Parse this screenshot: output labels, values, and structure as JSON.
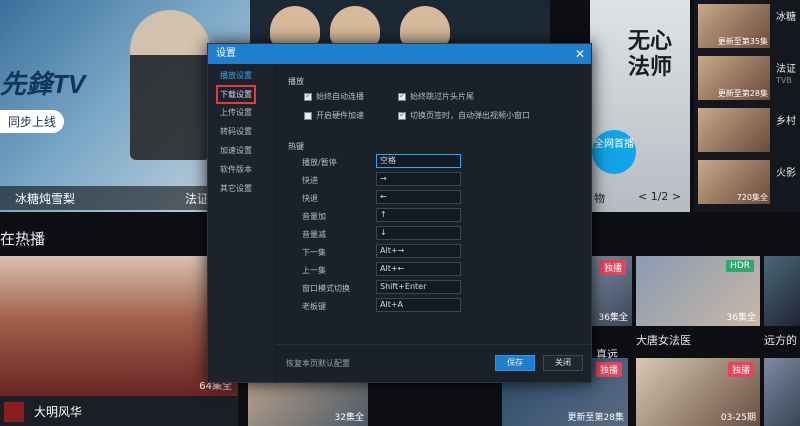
{
  "hero": {
    "logo": "先鋒TV",
    "sync": "同步上线",
    "caption_left": "冰糖炖雪梨",
    "caption_right": "法证先锋4",
    "side_title": "无心法师",
    "live_badge": "全网首播",
    "category": "物",
    "pager": "< 1/2 >"
  },
  "side_list": [
    {
      "name": "冰糖",
      "sub": "",
      "caption": "更新至第35集"
    },
    {
      "name": "法证",
      "sub": "TVB",
      "caption": "更新至第28集"
    },
    {
      "name": "乡村",
      "sub": "",
      "caption": ""
    },
    {
      "name": "火影",
      "sub": "",
      "caption": "720集全"
    }
  ],
  "section_title": "在热播",
  "big_poster": {
    "title": "大明风华",
    "caption": "64集全"
  },
  "tiles": [
    {
      "title": "真远",
      "caption": "36集全",
      "badge": "独播"
    },
    {
      "title": "大唐女法医",
      "caption": "36集全",
      "badge": "HDR"
    },
    {
      "title": "远方的",
      "caption": "",
      "badge": ""
    },
    {
      "title": "",
      "caption": "32集全",
      "badge": ""
    },
    {
      "title": "",
      "caption": "更新至第28集",
      "badge": "独播"
    },
    {
      "title": "",
      "caption": "03-25期",
      "badge": "独播"
    }
  ],
  "dialog": {
    "title": "设置",
    "close": "✕",
    "nav": [
      "播放设置",
      "下载设置",
      "上传设置",
      "转码设置",
      "加速设置",
      "软件版本",
      "其它设置"
    ],
    "playback_group": "播放",
    "checks": [
      {
        "label": "始终自动连播",
        "checked": true
      },
      {
        "label": "始终跳过片头片尾",
        "checked": true
      },
      {
        "label": "开启硬件加速",
        "checked": false
      },
      {
        "label": "切换页签时，自动弹出视频小窗口",
        "checked": true
      }
    ],
    "hotkey_group": "热键",
    "hotkeys": [
      {
        "label": "播放/暂停",
        "value": "空格"
      },
      {
        "label": "快进",
        "value": "→"
      },
      {
        "label": "快退",
        "value": "←"
      },
      {
        "label": "音量加",
        "value": "↑"
      },
      {
        "label": "音量减",
        "value": "↓"
      },
      {
        "label": "下一集",
        "value": "Alt+→"
      },
      {
        "label": "上一集",
        "value": "Alt+←"
      },
      {
        "label": "窗口模式切换",
        "value": "Shift+Enter"
      },
      {
        "label": "老板键",
        "value": "Alt+A"
      }
    ],
    "reset": "恢复本页默认配置",
    "save": "保存",
    "close_btn": "关闭"
  }
}
